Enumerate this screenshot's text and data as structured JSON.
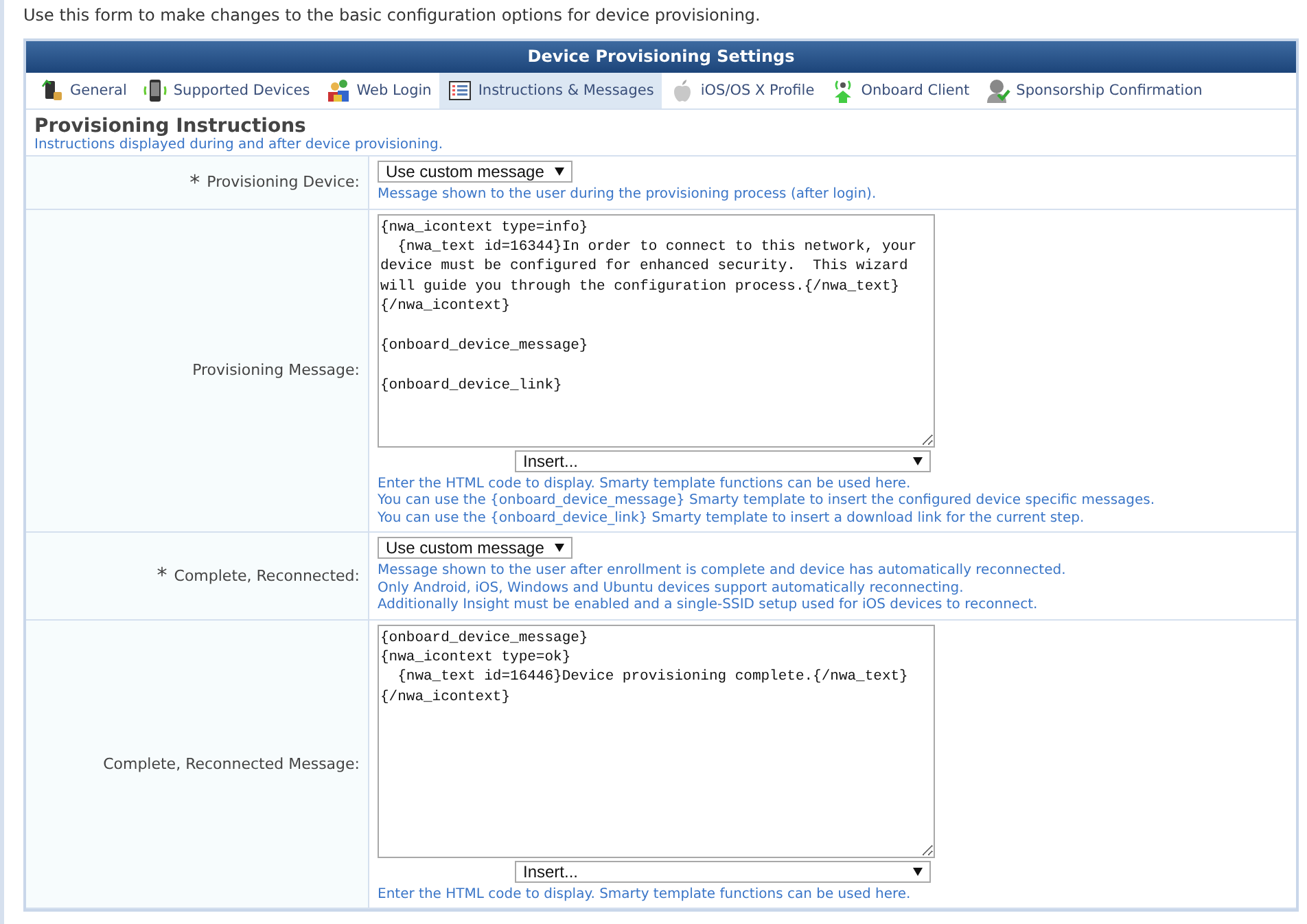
{
  "intro": "Use this form to make changes to the basic configuration options for device provisioning.",
  "panel": {
    "title": "Device Provisioning Settings"
  },
  "tabs": [
    {
      "label": "General",
      "selected": false
    },
    {
      "label": "Supported Devices",
      "selected": false
    },
    {
      "label": "Web Login",
      "selected": false
    },
    {
      "label": "Instructions & Messages",
      "selected": true
    },
    {
      "label": "iOS/OS X Profile",
      "selected": false
    },
    {
      "label": "Onboard Client",
      "selected": false
    },
    {
      "label": "Sponsorship Confirmation",
      "selected": false
    }
  ],
  "section": {
    "title": "Provisioning Instructions",
    "subtitle": "Instructions displayed during and after device provisioning."
  },
  "rows": [
    {
      "kind": "select",
      "label": "Provisioning Device:",
      "required_mark": "*",
      "value": "Use custom message",
      "hints": [
        "Message shown to the user during the provisioning process (after login)."
      ]
    },
    {
      "kind": "textarea",
      "label": "Provisioning Message:",
      "value": "{nwa_icontext type=info}\n  {nwa_text id=16344}In order to connect to this network, your\ndevice must be configured for enhanced security.  This wizard\nwill guide you through the configuration process.{/nwa_text}\n{/nwa_icontext}\n\n{onboard_device_message}\n\n{onboard_device_link}",
      "insert": "Insert...",
      "hints": [
        "Enter the HTML code to display. Smarty template functions can be used here.",
        "You can use the {onboard_device_message} Smarty template to insert the configured device specific messages.",
        "You can use the {onboard_device_link} Smarty template to insert a download link for the current step."
      ]
    },
    {
      "kind": "select",
      "label": "Complete, Reconnected:",
      "required_mark": "*",
      "value": "Use custom message",
      "hints": [
        "Message shown to the user after enrollment is complete and device has automatically reconnected.",
        "Only Android, iOS, Windows and Ubuntu devices support automatically reconnecting.",
        "Additionally Insight must be enabled and a single-SSID setup used for iOS devices to reconnect."
      ]
    },
    {
      "kind": "textarea",
      "label": "Complete, Reconnected Message:",
      "value": "{onboard_device_message}\n{nwa_icontext type=ok}\n  {nwa_text id=16446}Device provisioning complete.{/nwa_text}\n{/nwa_icontext}",
      "insert": "Insert...",
      "hints": [
        "Enter the HTML code to display. Smarty template functions can be used here."
      ]
    }
  ]
}
